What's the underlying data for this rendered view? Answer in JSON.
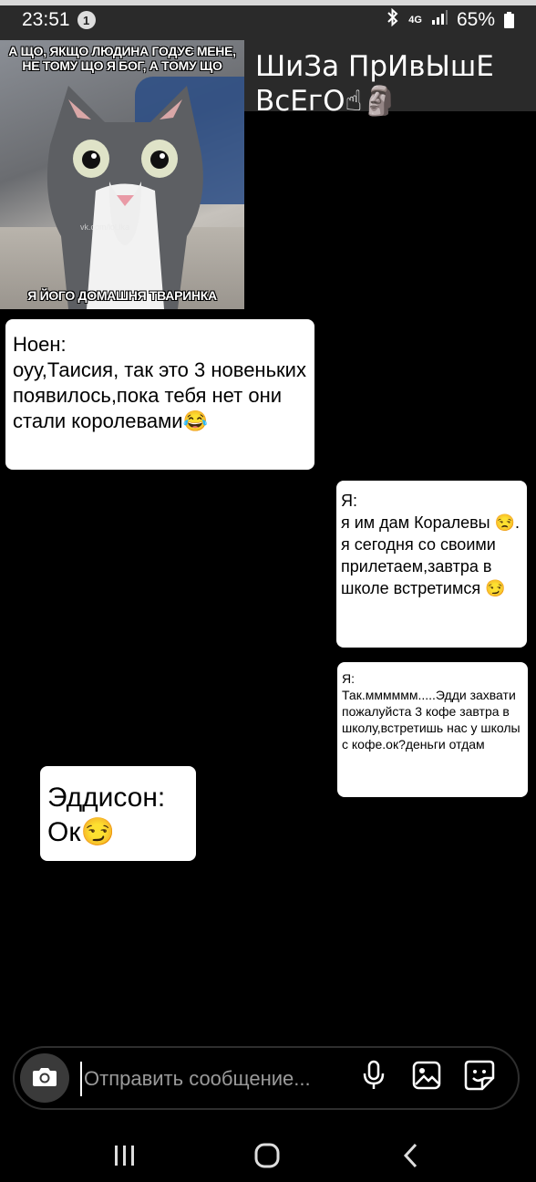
{
  "status_bar": {
    "time": "23:51",
    "notification_count": "1",
    "network": "4G",
    "battery": "65%"
  },
  "chat": {
    "title": "ШиЗа ПрИвЫшЕ ВсЕгО☝🗿"
  },
  "meme": {
    "top_caption": "А ЩО, ЯКЩО ЛЮДИНА ГОДУЄ МЕНЕ, НЕ ТОМУ ЩО Я БОГ, А ТОМУ ЩО",
    "bottom_caption": "Я ЙОГО ДОМАШНЯ ТВАРИНКА",
    "watermark": "vk.com/lol.lka"
  },
  "messages": [
    {
      "text": "Ноен:\nоуу,Таисия, так это 3 новеньких появилось,пока тебя нет они стали королевами😂"
    },
    {
      "text": "Я:\nя им дам Коралевы 😒. я сегодня со своими прилетаем,завтра в школе встретимся 😏"
    },
    {
      "text": "Я:\nТак.мммммм.....Эдди захвати пожалуйста 3 кофе завтра в школу,встретишь нас у школы с кофе.ок?деньги отдам"
    },
    {
      "text": "Эддисон:\nОк😏"
    }
  ],
  "composer": {
    "placeholder": "Отправить сообщение..."
  },
  "icons": {
    "camera": "camera-icon",
    "mic": "microphone-icon",
    "gallery": "image-icon",
    "sticker": "sticker-icon"
  }
}
